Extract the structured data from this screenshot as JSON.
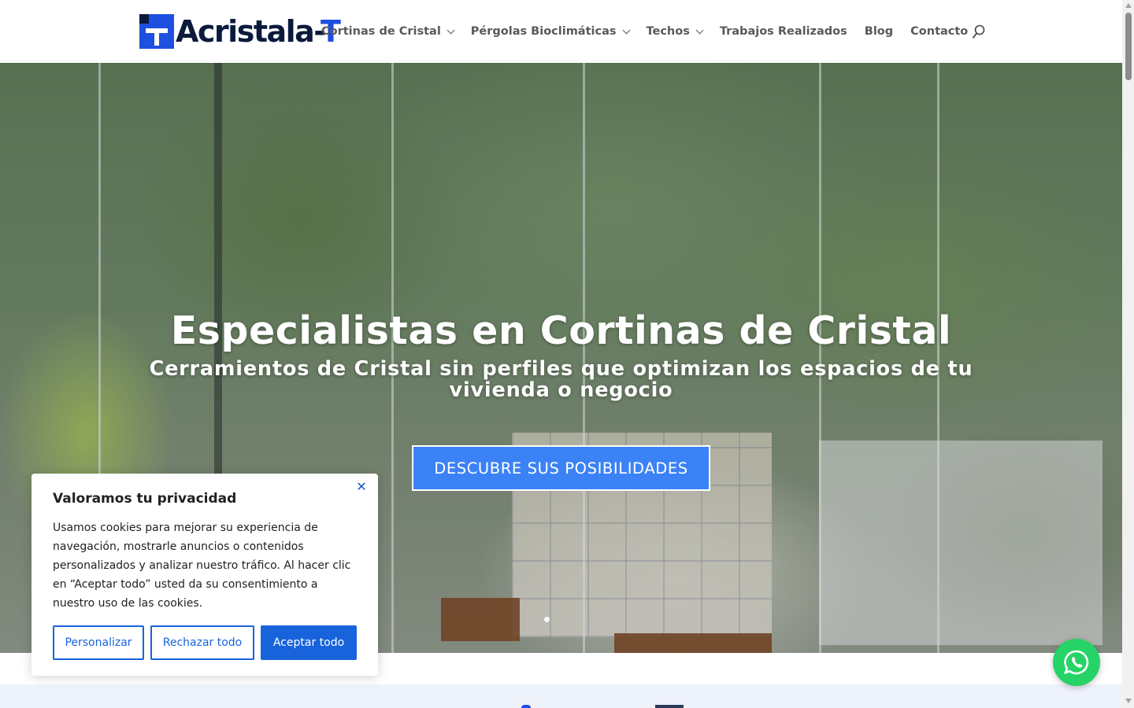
{
  "brand": {
    "name_main": "Acristala-",
    "name_accent": "T",
    "accent_color": "#1f4fe0",
    "dark_color": "#0b1a3c"
  },
  "nav": {
    "items": [
      {
        "label": "Cortinas de Cristal",
        "has_dropdown": true
      },
      {
        "label": "Pérgolas Bioclimáticas",
        "has_dropdown": true
      },
      {
        "label": "Techos",
        "has_dropdown": true
      },
      {
        "label": "Trabajos Realizados",
        "has_dropdown": false
      },
      {
        "label": "Blog",
        "has_dropdown": false
      },
      {
        "label": "Contacto",
        "has_dropdown": false
      }
    ],
    "search_icon": "search-icon"
  },
  "hero": {
    "title": "Especialistas en Cortinas de Cristal",
    "subtitle": "Cerramientos de Cristal sin perfiles que optimizan los espacios de tu vivienda o negocio",
    "cta_label": "DESCUBRE SUS POSIBILIDADES",
    "cta_color": "#3b82f6"
  },
  "cookie_banner": {
    "title": "Valoramos tu privacidad",
    "text": "Usamos cookies para mejorar su experiencia de navegación, mostrarle anuncios o contenidos personalizados y analizar nuestro tráfico. Al hacer clic en “Aceptar todo” usted da su consentimiento a nuestro uso de las cookies.",
    "customize_label": "Personalizar",
    "reject_label": "Rechazar todo",
    "accept_label": "Aceptar todo",
    "button_color": "#1863dc"
  },
  "whatsapp": {
    "icon": "whatsapp-icon",
    "color": "#25d366"
  }
}
